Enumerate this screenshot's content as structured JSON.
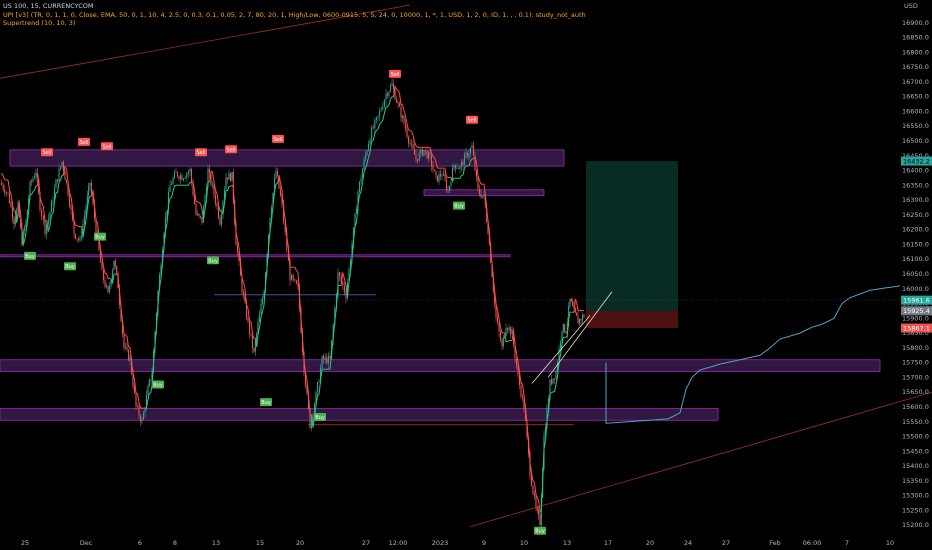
{
  "legend": {
    "symbol": "US 100, 15, CURRENCYCOM",
    "indicator": "UPI [v3] (TR, 0, 1, 1, 0, Close, EMA, 50, 0, 1, 10, 4, 2.5, 0, 0.3, 0.1, 0.05, 2, 7, 80, 20, 1, High/Low, 0600-0915, 5, 5, 24, 0, 10000, 1, *, 1, USD, 1, 2, 0, ID, 1, , , 0.1): study_not_auth",
    "supertrend": "Supertrend (10, 10, 3)"
  },
  "currency_label": "USD",
  "colors": {
    "background": "#000000",
    "bull": "#26a69a",
    "bear": "#ef5350",
    "zone_fill": "#3a1c4f",
    "zone_border": "#9c27b0",
    "st_up": "#2ecc71",
    "st_down": "#ff4d4d",
    "projection": "#4fa3c7",
    "blue_line": "#3f51b5"
  },
  "chart_data": {
    "type": "candlestick",
    "ylim": [
      15150,
      16950
    ],
    "price_ticks": [
      15200,
      15250,
      15300,
      15350,
      15400,
      15450,
      15500,
      15550,
      15600,
      15650,
      15700,
      15750,
      15800,
      15850,
      15900,
      15950,
      16000,
      16050,
      16100,
      16150,
      16200,
      16250,
      16300,
      16350,
      16400,
      16450,
      16500,
      16550,
      16600,
      16650,
      16700,
      16750,
      16800,
      16850,
      16900
    ],
    "price_tick_labels": [
      "15200.0",
      "15250.0",
      "15300.0",
      "15350.0",
      "15400.0",
      "15450.0",
      "15500.0",
      "15550.0",
      "15600.0",
      "15650.0",
      "15700.0",
      "15750.0",
      "15800.0",
      "15850.0",
      "15900.0",
      "15950.0",
      "16000.0",
      "16050.0",
      "16100.0",
      "16150.0",
      "16200.0",
      "16250.0",
      "16300.0",
      "16350.0",
      "16400.0",
      "16450.0",
      "16500.0",
      "16550.0",
      "16600.0",
      "16650.0",
      "16700.0",
      "16750.0",
      "16800.0",
      "16850.0",
      "16900.0"
    ],
    "time_labels": [
      "25",
      "Dec",
      "6",
      "8",
      "13",
      "15",
      "20",
      "27",
      "12:00",
      "2023",
      "9",
      "10",
      "13",
      "17",
      "20",
      "24",
      "27",
      "Feb",
      "06:00",
      "7",
      "10"
    ],
    "badges": {
      "up": "16432.2",
      "mid1": "15961.6",
      "mid2": "15925.4",
      "down": "15867.1"
    },
    "buy_label": "Buy",
    "sell_label": "Sell",
    "buy_count": 10,
    "sell_count": 9,
    "zones": [
      {
        "low": 16415,
        "high": 16470
      },
      {
        "low": 16315,
        "high": 16335
      },
      {
        "low": 16110,
        "high": 16115
      },
      {
        "low": 15720,
        "high": 15760
      },
      {
        "low": 15555,
        "high": 15595
      }
    ],
    "hlines": [
      15980,
      15540
    ],
    "keypoints": [
      [
        0,
        16360
      ],
      [
        8,
        16320
      ],
      [
        14,
        16230
      ],
      [
        18,
        16280
      ],
      [
        22,
        16160
      ],
      [
        26,
        16230
      ],
      [
        30,
        16350
      ],
      [
        36,
        16400
      ],
      [
        40,
        16280
      ],
      [
        45,
        16200
      ],
      [
        50,
        16260
      ],
      [
        56,
        16360
      ],
      [
        62,
        16430
      ],
      [
        68,
        16330
      ],
      [
        74,
        16190
      ],
      [
        80,
        16160
      ],
      [
        86,
        16280
      ],
      [
        90,
        16360
      ],
      [
        96,
        16200
      ],
      [
        102,
        16050
      ],
      [
        108,
        15980
      ],
      [
        114,
        16100
      ],
      [
        118,
        16010
      ],
      [
        124,
        15800
      ],
      [
        130,
        15760
      ],
      [
        136,
        15600
      ],
      [
        142,
        15550
      ],
      [
        148,
        15660
      ],
      [
        152,
        15720
      ],
      [
        158,
        15990
      ],
      [
        164,
        16200
      ],
      [
        170,
        16350
      ],
      [
        176,
        16390
      ],
      [
        182,
        16380
      ],
      [
        190,
        16400
      ],
      [
        196,
        16250
      ],
      [
        202,
        16230
      ],
      [
        208,
        16400
      ],
      [
        214,
        16320
      ],
      [
        220,
        16230
      ],
      [
        226,
        16380
      ],
      [
        232,
        16380
      ],
      [
        236,
        16160
      ],
      [
        242,
        16000
      ],
      [
        248,
        15880
      ],
      [
        254,
        15780
      ],
      [
        258,
        15880
      ],
      [
        264,
        16000
      ],
      [
        270,
        16250
      ],
      [
        276,
        16400
      ],
      [
        282,
        16280
      ],
      [
        290,
        16040
      ],
      [
        298,
        16000
      ],
      [
        304,
        15730
      ],
      [
        310,
        15540
      ],
      [
        316,
        15640
      ],
      [
        322,
        15760
      ],
      [
        330,
        15760
      ],
      [
        338,
        16050
      ],
      [
        346,
        15980
      ],
      [
        352,
        16150
      ],
      [
        358,
        16330
      ],
      [
        364,
        16430
      ],
      [
        370,
        16520
      ],
      [
        378,
        16580
      ],
      [
        386,
        16660
      ],
      [
        392,
        16690
      ],
      [
        398,
        16620
      ],
      [
        404,
        16560
      ],
      [
        410,
        16490
      ],
      [
        416,
        16440
      ],
      [
        424,
        16470
      ],
      [
        430,
        16440
      ],
      [
        436,
        16370
      ],
      [
        442,
        16390
      ],
      [
        448,
        16330
      ],
      [
        454,
        16420
      ],
      [
        460,
        16410
      ],
      [
        466,
        16450
      ],
      [
        472,
        16480
      ],
      [
        478,
        16330
      ],
      [
        484,
        16310
      ],
      [
        488,
        16200
      ],
      [
        492,
        16050
      ],
      [
        496,
        15900
      ],
      [
        502,
        15800
      ],
      [
        506,
        15880
      ],
      [
        512,
        15850
      ],
      [
        518,
        15700
      ],
      [
        524,
        15600
      ],
      [
        530,
        15380
      ],
      [
        536,
        15250
      ],
      [
        540,
        15210
      ],
      [
        544,
        15500
      ],
      [
        550,
        15680
      ],
      [
        556,
        15720
      ],
      [
        562,
        15870
      ],
      [
        566,
        15860
      ],
      [
        570,
        15960
      ],
      [
        574,
        15920
      ],
      [
        578,
        15890
      ],
      [
        584,
        15910
      ]
    ],
    "projection": [
      [
        606,
        15750
      ],
      [
        606,
        15545
      ],
      [
        650,
        15555
      ],
      [
        668,
        15560
      ],
      [
        680,
        15580
      ],
      [
        686,
        15660
      ],
      [
        692,
        15700
      ],
      [
        700,
        15725
      ],
      [
        720,
        15745
      ],
      [
        740,
        15760
      ],
      [
        760,
        15775
      ],
      [
        770,
        15800
      ],
      [
        780,
        15830
      ],
      [
        800,
        15850
      ],
      [
        812,
        15870
      ],
      [
        822,
        15880
      ],
      [
        834,
        15900
      ],
      [
        842,
        15950
      ],
      [
        850,
        15970
      ],
      [
        870,
        15995
      ],
      [
        900,
        16010
      ]
    ],
    "position": {
      "entry": 15925,
      "tp": 16432,
      "sl": 15867
    }
  }
}
